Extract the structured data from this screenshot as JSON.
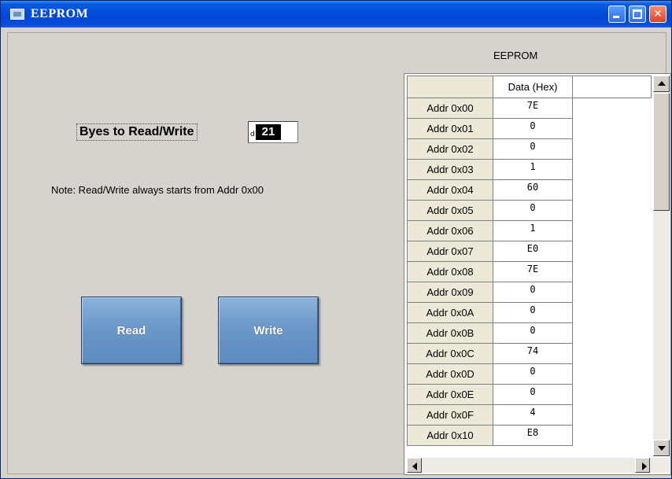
{
  "window": {
    "title": "EEPROM",
    "icon": "app-window-icon",
    "controls": [
      "minimize-icon",
      "maximize-icon",
      "close-icon"
    ]
  },
  "bytes_control": {
    "label": "Byes to Read/Write",
    "radix": "d",
    "value": "21"
  },
  "note": "Note: Read/Write always starts from Addr 0x00",
  "buttons": {
    "read": "Read",
    "write": "Write"
  },
  "table": {
    "caption": "EEPROM",
    "column_header": "Data (Hex)",
    "rows": [
      {
        "addr": "Addr 0x00",
        "value": "7E"
      },
      {
        "addr": "Addr 0x01",
        "value": "0"
      },
      {
        "addr": "Addr 0x02",
        "value": "0"
      },
      {
        "addr": "Addr 0x03",
        "value": "1"
      },
      {
        "addr": "Addr 0x04",
        "value": "60"
      },
      {
        "addr": "Addr 0x05",
        "value": "0"
      },
      {
        "addr": "Addr 0x06",
        "value": "1"
      },
      {
        "addr": "Addr 0x07",
        "value": "E0"
      },
      {
        "addr": "Addr 0x08",
        "value": "7E"
      },
      {
        "addr": "Addr 0x09",
        "value": "0"
      },
      {
        "addr": "Addr 0x0A",
        "value": "0"
      },
      {
        "addr": "Addr 0x0B",
        "value": "0"
      },
      {
        "addr": "Addr 0x0C",
        "value": "74"
      },
      {
        "addr": "Addr 0x0D",
        "value": "0"
      },
      {
        "addr": "Addr 0x0E",
        "value": "0"
      },
      {
        "addr": "Addr 0x0F",
        "value": "4"
      },
      {
        "addr": "Addr 0x10",
        "value": "E8"
      }
    ]
  },
  "colors": {
    "titlebar": "#0046d5",
    "button_face": "#6b98c9",
    "panel": "#d6d3ce"
  }
}
